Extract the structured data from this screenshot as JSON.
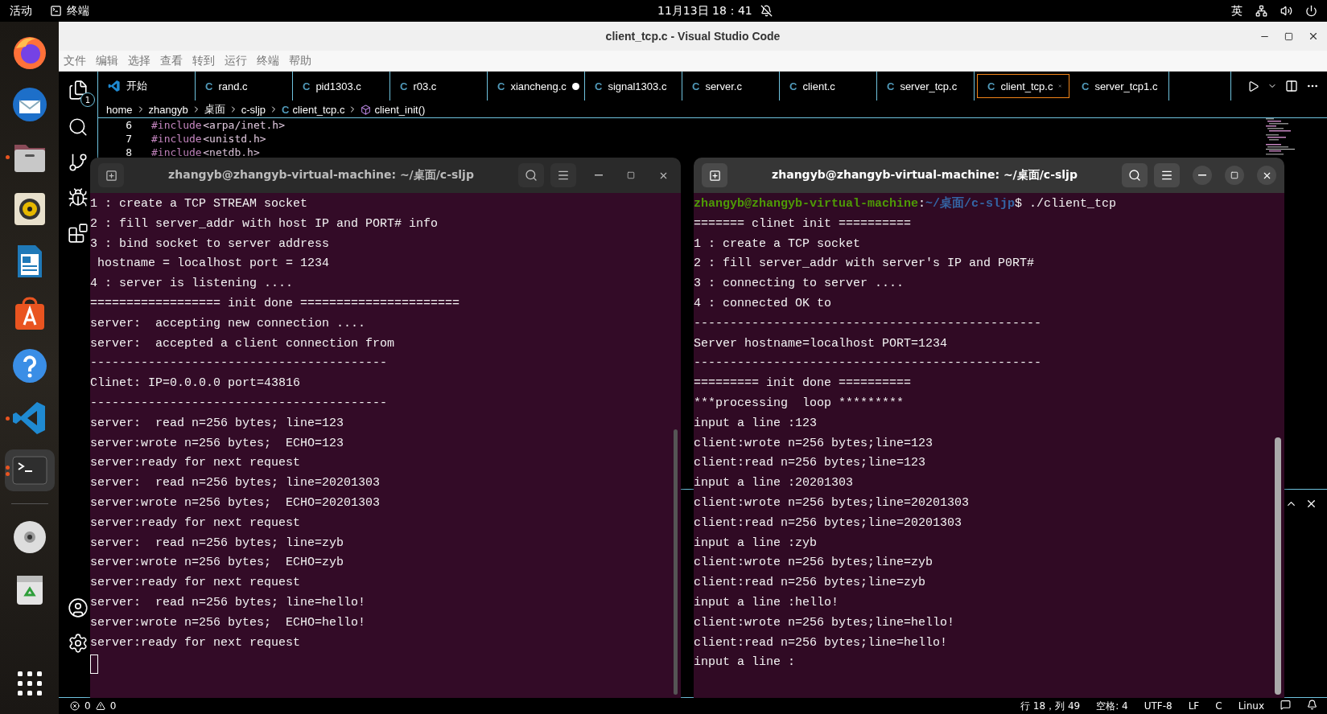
{
  "top_bar": {
    "activities": "活动",
    "app_name": "终端",
    "clock": "11月13日  18：41",
    "input_method": "英"
  },
  "dock": {
    "items": [
      {
        "kind": "firefox",
        "running": false,
        "multiple_windows": false,
        "selected": false
      },
      {
        "kind": "mail",
        "running": false,
        "multiple_windows": false,
        "selected": false
      },
      {
        "kind": "files",
        "running": true,
        "multiple_windows": false,
        "selected": false
      },
      {
        "kind": "music",
        "running": false,
        "multiple_windows": false,
        "selected": false
      },
      {
        "kind": "writer",
        "running": false,
        "multiple_windows": false,
        "selected": false
      },
      {
        "kind": "store",
        "running": false,
        "multiple_windows": false,
        "selected": false
      },
      {
        "kind": "help",
        "running": false,
        "multiple_windows": false,
        "selected": false
      },
      {
        "kind": "code",
        "running": true,
        "multiple_windows": false,
        "selected": false
      },
      {
        "kind": "terminal",
        "running": true,
        "multiple_windows": true,
        "selected": true
      }
    ],
    "more_items": [
      {
        "kind": "disc",
        "running": false,
        "multiple_windows": false,
        "selected": false
      },
      {
        "kind": "trash",
        "running": false,
        "multiple_windows": false,
        "selected": false
      }
    ]
  },
  "vscode": {
    "title": "client_tcp.c - Visual Studio Code",
    "menu": [
      "文件",
      "编辑",
      "选择",
      "查看",
      "转到",
      "运行",
      "终端",
      "帮助"
    ],
    "explorer_badge": "1",
    "tabs": [
      {
        "kind": "start",
        "label": "开始",
        "selected": false,
        "modified": false
      },
      {
        "kind": "c",
        "icon": "C",
        "label": "rand.c",
        "selected": false,
        "modified": false
      },
      {
        "kind": "c",
        "icon": "C",
        "label": "pid1303.c",
        "selected": false,
        "modified": false
      },
      {
        "kind": "c",
        "icon": "C",
        "label": "r03.c",
        "selected": false,
        "modified": false
      },
      {
        "kind": "c",
        "icon": "C",
        "label": "xiancheng.c",
        "selected": false,
        "modified": true
      },
      {
        "kind": "c",
        "icon": "C",
        "label": "signal1303.c",
        "selected": false,
        "modified": false
      },
      {
        "kind": "c",
        "icon": "C",
        "label": "server.c",
        "selected": false,
        "modified": false
      },
      {
        "kind": "c",
        "icon": "C",
        "label": "client.c",
        "selected": false,
        "modified": false
      },
      {
        "kind": "c",
        "icon": "C",
        "label": "server_tcp.c",
        "selected": false,
        "modified": false
      },
      {
        "kind": "c",
        "icon": "C",
        "label": "client_tcp.c",
        "selected": true,
        "modified": false
      },
      {
        "kind": "c",
        "icon": "C",
        "label": "server_tcp1.c",
        "selected": false,
        "modified": false
      }
    ],
    "breadcrumb": [
      {
        "kind": "folder",
        "label": "home"
      },
      {
        "kind": "folder",
        "label": "zhangyb"
      },
      {
        "kind": "folder",
        "label": "桌面"
      },
      {
        "kind": "folder",
        "label": "c-sljp"
      },
      {
        "kind": "file",
        "icon": "C",
        "label": "client_tcp.c"
      },
      {
        "kind": "symbol",
        "label": "client_init()"
      }
    ],
    "code_lines": [
      {
        "number": "6",
        "directive": "#include",
        "header": "<arpa/inet.h>"
      },
      {
        "number": "7",
        "directive": "#include",
        "header": "<unistd.h>"
      },
      {
        "number": "8",
        "directive": "#include",
        "header": "<netdb.h>"
      }
    ],
    "status_bar": {
      "errors": "0",
      "warnings": "0",
      "items": [
        "行 18，列 49",
        "空格: 4",
        "UTF-8",
        "LF",
        "C",
        "Linux"
      ]
    }
  },
  "terminals": [
    {
      "title": "zhangyb@zhangyb-virtual-machine: ~/桌面/c-sljp",
      "focused": false,
      "cursor": true,
      "lines": [
        "1 : create a TCP STREAM socket",
        "2 : fill server_addr with host IP and PORT# info",
        "3 : bind socket to server address",
        " hostname = localhost port = 1234",
        "4 : server is listening ....",
        "================== init done ======================",
        "server:  accepting new connection ....",
        "server:  accepted a client connection from",
        "-----------------------------------------",
        "Clinet: IP=0.0.0.0 port=43816",
        "-----------------------------------------",
        "server:  read n=256 bytes; line=123",
        "server:wrote n=256 bytes;  ECHO=123",
        "server:ready for next request",
        "server:  read n=256 bytes; line=20201303",
        "server:wrote n=256 bytes;  ECHO=20201303",
        "server:ready for next request",
        "server:  read n=256 bytes; line=zyb",
        "server:wrote n=256 bytes;  ECHO=zyb",
        "server:ready for next request",
        "server:  read n=256 bytes; line=hello!",
        "server:wrote n=256 bytes;  ECHO=hello!",
        "server:ready for next request"
      ]
    },
    {
      "title": "zhangyb@zhangyb-virtual-machine: ~/桌面/c-sljp",
      "focused": true,
      "cursor": false,
      "prompt": {
        "user_host": "zhangyb@zhangyb-virtual-machine",
        "separator": ":",
        "path": "~/桌面/c-sljp",
        "command": "$ ./client_tcp"
      },
      "lines": [
        "======= clinet init ==========",
        "1 : create a TCP socket",
        "2 : fill server_addr with server's IP and P0RT#",
        "3 : connecting to server ....",
        "4 : connected OK to",
        "------------------------------------------------",
        "Server hostname=localhost PORT=1234",
        "------------------------------------------------",
        "========= init done ==========",
        "***processing  loop *********",
        "input a line :123",
        "client:wrote n=256 bytes;line=123",
        "client:read n=256 bytes;line=123",
        "input a line :20201303",
        "client:wrote n=256 bytes;line=20201303",
        "client:read n=256 bytes;line=20201303",
        "input a line :zyb",
        "client:wrote n=256 bytes;line=zyb",
        "client:read n=256 bytes;line=zyb",
        "input a line :hello!",
        "client:wrote n=256 bytes;line=hello!",
        "client:read n=256 bytes;line=hello!",
        "input a line :"
      ]
    }
  ]
}
